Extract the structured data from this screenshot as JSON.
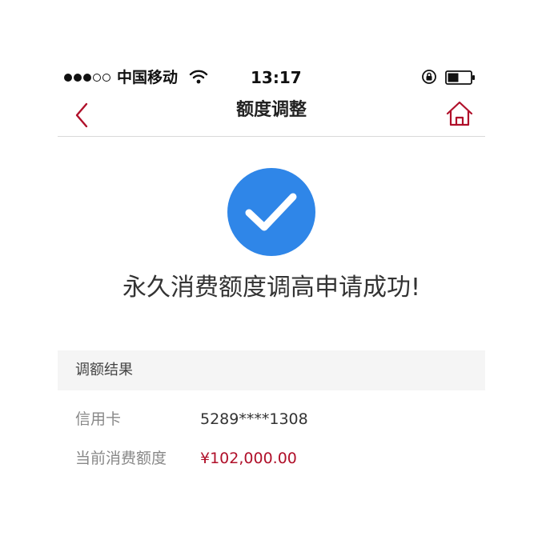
{
  "status_bar": {
    "carrier": "中国移动",
    "time": "13:17",
    "signal_full": 3,
    "signal_total": 5
  },
  "nav": {
    "title": "额度调整",
    "back_icon": "chevron-left-icon",
    "home_icon": "home-icon",
    "accent_color": "#b0102a"
  },
  "success": {
    "icon": "checkmark-icon",
    "icon_color": "#2f86e8",
    "message": "永久消费额度调高申请成功!"
  },
  "result": {
    "section_title": "调额结果",
    "rows": [
      {
        "label": "信用卡",
        "value": "5289****1308"
      },
      {
        "label": "当前消费额度",
        "value": "¥102,000.00"
      }
    ]
  }
}
